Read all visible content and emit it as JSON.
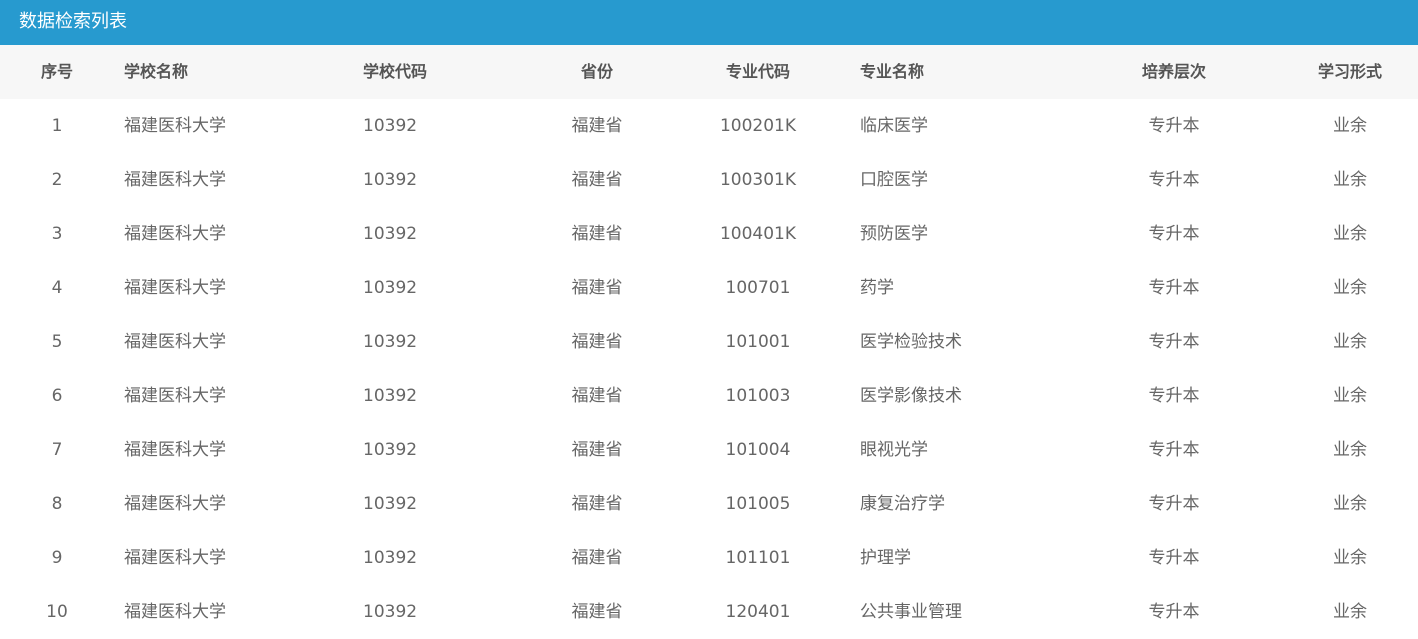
{
  "panel": {
    "title": "数据检索列表",
    "accent_color": "#279acf"
  },
  "table": {
    "columns": [
      "序号",
      "学校名称",
      "学校代码",
      "省份",
      "专业代码",
      "专业名称",
      "培养层次",
      "学习形式"
    ],
    "rows": [
      [
        "1",
        "福建医科大学",
        "10392",
        "福建省",
        "100201K",
        "临床医学",
        "专升本",
        "业余"
      ],
      [
        "2",
        "福建医科大学",
        "10392",
        "福建省",
        "100301K",
        "口腔医学",
        "专升本",
        "业余"
      ],
      [
        "3",
        "福建医科大学",
        "10392",
        "福建省",
        "100401K",
        "预防医学",
        "专升本",
        "业余"
      ],
      [
        "4",
        "福建医科大学",
        "10392",
        "福建省",
        "100701",
        "药学",
        "专升本",
        "业余"
      ],
      [
        "5",
        "福建医科大学",
        "10392",
        "福建省",
        "101001",
        "医学检验技术",
        "专升本",
        "业余"
      ],
      [
        "6",
        "福建医科大学",
        "10392",
        "福建省",
        "101003",
        "医学影像技术",
        "专升本",
        "业余"
      ],
      [
        "7",
        "福建医科大学",
        "10392",
        "福建省",
        "101004",
        "眼视光学",
        "专升本",
        "业余"
      ],
      [
        "8",
        "福建医科大学",
        "10392",
        "福建省",
        "101005",
        "康复治疗学",
        "专升本",
        "业余"
      ],
      [
        "9",
        "福建医科大学",
        "10392",
        "福建省",
        "101101",
        "护理学",
        "专升本",
        "业余"
      ],
      [
        "10",
        "福建医科大学",
        "10392",
        "福建省",
        "120401",
        "公共事业管理",
        "专升本",
        "业余"
      ]
    ]
  }
}
